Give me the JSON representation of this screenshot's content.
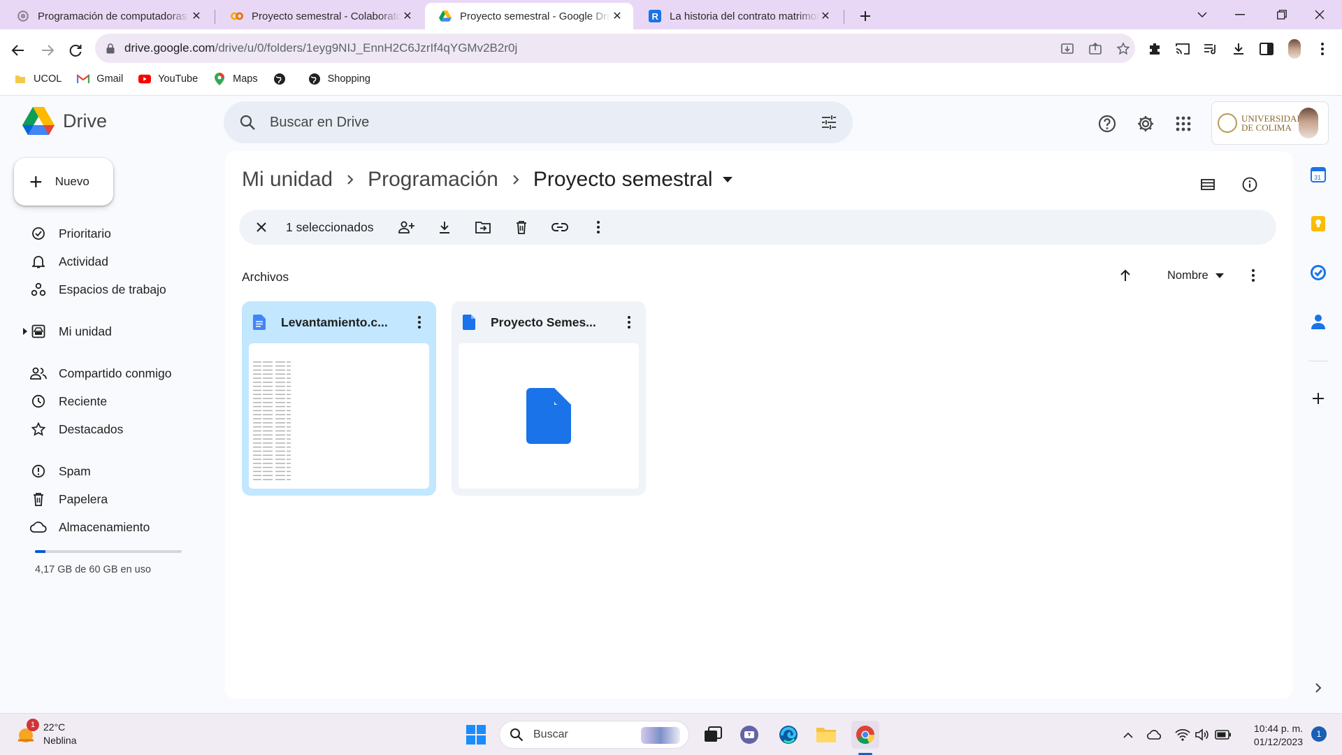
{
  "browser": {
    "tabs": [
      {
        "title": "Programación de computadoras",
        "icon": "ucol-icon"
      },
      {
        "title": "Proyecto semestral - Colaboratory",
        "icon": "colab-icon"
      },
      {
        "title": "Proyecto semestral - Google Drive",
        "icon": "drive-icon",
        "active": true
      },
      {
        "title": "La historia del contrato matrimonial",
        "icon": "r-icon"
      }
    ],
    "url_host": "drive.google.com",
    "url_path": "/drive/u/0/folders/1eyg9NIJ_EnnH2C6JzrIf4qYGMv2B2r0j",
    "bookmarks": [
      {
        "label": "UCOL",
        "icon": "folder-icon"
      },
      {
        "label": "Gmail",
        "icon": "gmail-icon"
      },
      {
        "label": "YouTube",
        "icon": "youtube-icon"
      },
      {
        "label": "Maps",
        "icon": "maps-icon"
      },
      {
        "label": "",
        "icon": "globe-icon"
      },
      {
        "label": "Shopping",
        "icon": "shopping-icon"
      }
    ]
  },
  "drive": {
    "logo_text": "Drive",
    "search_placeholder": "Buscar en Drive",
    "account_org": "UNIVERSIDAD DE COLIMA",
    "new_label": "Nuevo",
    "nav": [
      {
        "label": "Prioritario",
        "icon": "priority-icon"
      },
      {
        "label": "Actividad",
        "icon": "bell-icon"
      },
      {
        "label": "Espacios de trabajo",
        "icon": "workspaces-icon"
      },
      {
        "label": "Mi unidad",
        "icon": "my-drive-icon"
      },
      {
        "label": "Compartido conmigo",
        "icon": "shared-icon"
      },
      {
        "label": "Reciente",
        "icon": "clock-icon"
      },
      {
        "label": "Destacados",
        "icon": "star-icon"
      },
      {
        "label": "Spam",
        "icon": "spam-icon"
      },
      {
        "label": "Papelera",
        "icon": "trash-icon"
      },
      {
        "label": "Almacenamiento",
        "icon": "cloud-icon"
      }
    ],
    "storage_text": "4,17 GB de 60 GB en uso",
    "storage_fraction": 0.0695,
    "breadcrumb": [
      "Mi unidad",
      "Programación",
      "Proyecto semestral"
    ],
    "selection_label": "1 seleccionados",
    "section_title": "Archivos",
    "sort_label": "Nombre",
    "files": [
      {
        "name": "Levantamiento.c...",
        "selected": true
      },
      {
        "name": "Proyecto Semes...",
        "selected": false
      }
    ]
  },
  "taskbar": {
    "temp": "22°C",
    "weather": "Neblina",
    "weather_badge": "1",
    "search_label": "Buscar",
    "time": "10:44 p. m.",
    "date": "01/12/2023",
    "notifications": "1"
  },
  "colors": {
    "accent": "#0b57d0",
    "selected_card": "#c2e7ff",
    "tab_strip": "#e9d8f5"
  }
}
